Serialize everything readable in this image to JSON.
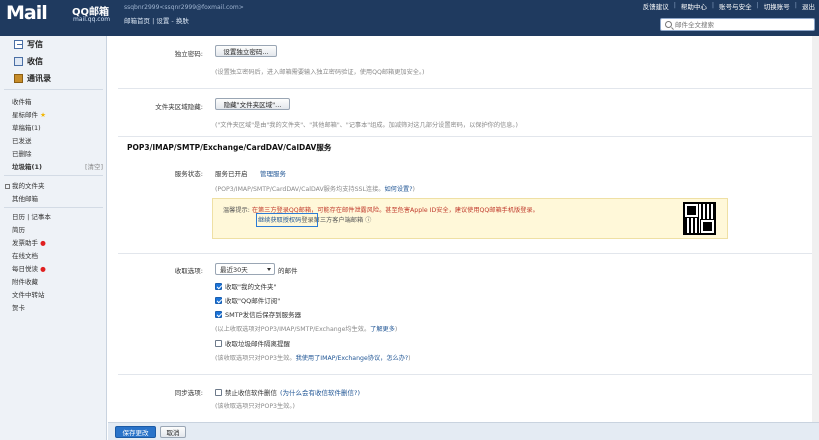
{
  "header": {
    "logo_text": "Mail",
    "logo_cn": "QQ邮箱",
    "logo_url": "mail.qq.com",
    "account": "ssqbnr2999<ssqnr2999@foxmail.com>",
    "breadcrumb": [
      "邮箱首页",
      "设置",
      "换肤"
    ],
    "top_links": [
      "反馈建议",
      "帮助中心",
      "账号与安全",
      "切换账号",
      "退出"
    ],
    "search_placeholder": "邮件全文搜索"
  },
  "sidebar": {
    "primary": [
      {
        "label": "写信",
        "icon": "write-icon"
      },
      {
        "label": "收信",
        "icon": "inbox-icon"
      },
      {
        "label": "通讯录",
        "icon": "contacts-icon"
      }
    ],
    "folders": [
      {
        "label": "收件箱"
      },
      {
        "label": "星标邮件"
      },
      {
        "label": "草稿箱(1)"
      },
      {
        "label": "已发送"
      },
      {
        "label": "已删除"
      },
      {
        "label": "垃圾箱(1)",
        "action": "[清空]"
      }
    ],
    "my_folders": "我的文件夹",
    "other_mail": "其他邮箱",
    "tools": [
      {
        "label": "日历 | 记事本"
      },
      {
        "label": "简历"
      },
      {
        "label": "发票助手"
      },
      {
        "label": "在线文档"
      },
      {
        "label": "每日悦读"
      },
      {
        "label": "附件收藏"
      },
      {
        "label": "文件中转站"
      },
      {
        "label": "贺卡"
      }
    ]
  },
  "settings": {
    "independent_password": {
      "label": "独立密码:",
      "button": "设置独立密码...",
      "hint": "(设置独立密码后，进入邮箱需要输入独立密码验证，使用QQ邮箱更加安全。)"
    },
    "folder_region": {
      "label": "文件夹区域隐藏:",
      "button": "隐藏\"文件夹区域\"...",
      "hint": "(\"文件夹区域\"是由\"我的文件夹\"、\"其他邮箱\"、\"记事本\"组成。加减筛对这几部分设置密码，以保护你的信息。)"
    },
    "pop3_section_title": "POP3/IMAP/SMTP/Exchange/CardDAV/CalDAV服务",
    "service_status": {
      "label": "服务状态:",
      "status": "服务已开启",
      "manage": "管理服务",
      "hint_pre": "(POP3/IMAP/SMTP/CardDAV/CalDAV服务均支持SSL连接。",
      "hint_link": "如何设置?",
      "hint_post": ")"
    },
    "warning": {
      "prefix": "温馨提示:",
      "line1": "在第三方登录QQ邮箱，可能存在邮件泄露风险。甚至危害Apple ID安全，建议使用QQ邮箱手机版登录。",
      "line2_link": "继续获取授权码",
      "line2_post": "登录第三方客户端邮箱"
    },
    "receive_options": {
      "label": "收取选项:",
      "select_value": "最近30天",
      "select_suffix": "的邮件",
      "checkboxes": [
        {
          "label": "收取\"我的文件夹\"",
          "checked": true
        },
        {
          "label": "收取\"QQ邮件订阅\"",
          "checked": true
        },
        {
          "label": "SMTP发信后保存到服务器",
          "checked": true
        }
      ],
      "hint1_pre": "(以上收取选项对POP3/IMAP/SMTP/Exchange均生效。",
      "hint1_link": "了解更多",
      "hint1_post": ")",
      "spam_checkbox": {
        "label": "收取垃圾邮件隔离提醒",
        "checked": false
      },
      "hint2_pre": "(该收取选项只对POP3生效。",
      "hint2_link": "我使用了IMAP/Exchange协议，怎么办?",
      "hint2_post": ")"
    },
    "sync_options": {
      "label": "同步选项:",
      "checkbox": {
        "label": "禁止收信软件删信",
        "checked": false
      },
      "checkbox_link": "(为什么会有收信软件删信?)",
      "hint": "(该收取选项只对POP3生效。)"
    }
  },
  "footer": {
    "save": "保存更改",
    "cancel": "取消"
  }
}
